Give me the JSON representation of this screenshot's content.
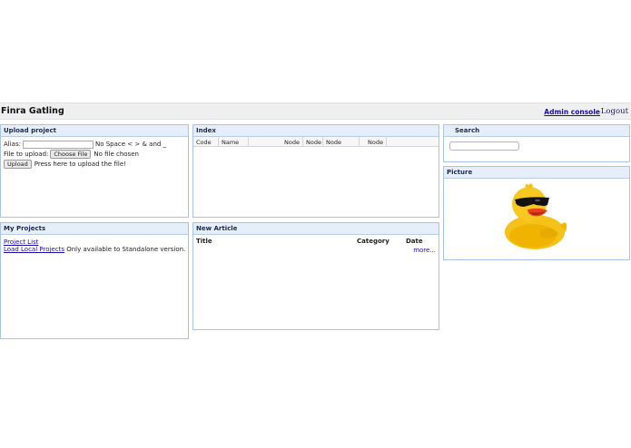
{
  "header": {
    "title": "Finra Gatling",
    "admin_label": "Admin console",
    "logout_label": "Logout"
  },
  "upload": {
    "title": "Upload project",
    "alias_label": "Alias:",
    "alias_value": "",
    "alias_hint": "No Space < > & and _",
    "file_label": "File to upload:",
    "choose_label": "Choose File",
    "file_status": "No file chosen",
    "upload_label": "Upload",
    "upload_hint": "Press here to upload the file!"
  },
  "index": {
    "title": "Index",
    "columns": [
      "Code",
      "Name",
      "Node",
      "Node",
      "Node",
      "Node"
    ]
  },
  "search": {
    "title": "Search",
    "value": ""
  },
  "picture": {
    "title": "Picture"
  },
  "projects": {
    "title": "My Projects",
    "project_list": "Project List",
    "load_local": "Load Local Projects",
    "load_note": "Only available to Standalone version."
  },
  "article": {
    "title": "New Article",
    "col_title": "Title",
    "col_category": "Category",
    "col_date": "Date",
    "more": "more..."
  }
}
